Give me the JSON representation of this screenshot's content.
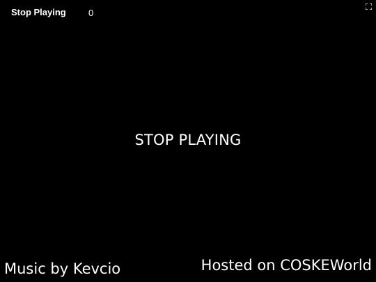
{
  "hud": {
    "title": "Stop Playing",
    "score": "0"
  },
  "center": {
    "message": "STOP PLAYING"
  },
  "credits": {
    "music": "Music by Kevcio",
    "host": "Hosted on COSKEWorld"
  },
  "controls": {
    "fullscreen_icon": "fullscreen-icon"
  },
  "colors": {
    "background": "#000000",
    "text": "#ffffff"
  }
}
